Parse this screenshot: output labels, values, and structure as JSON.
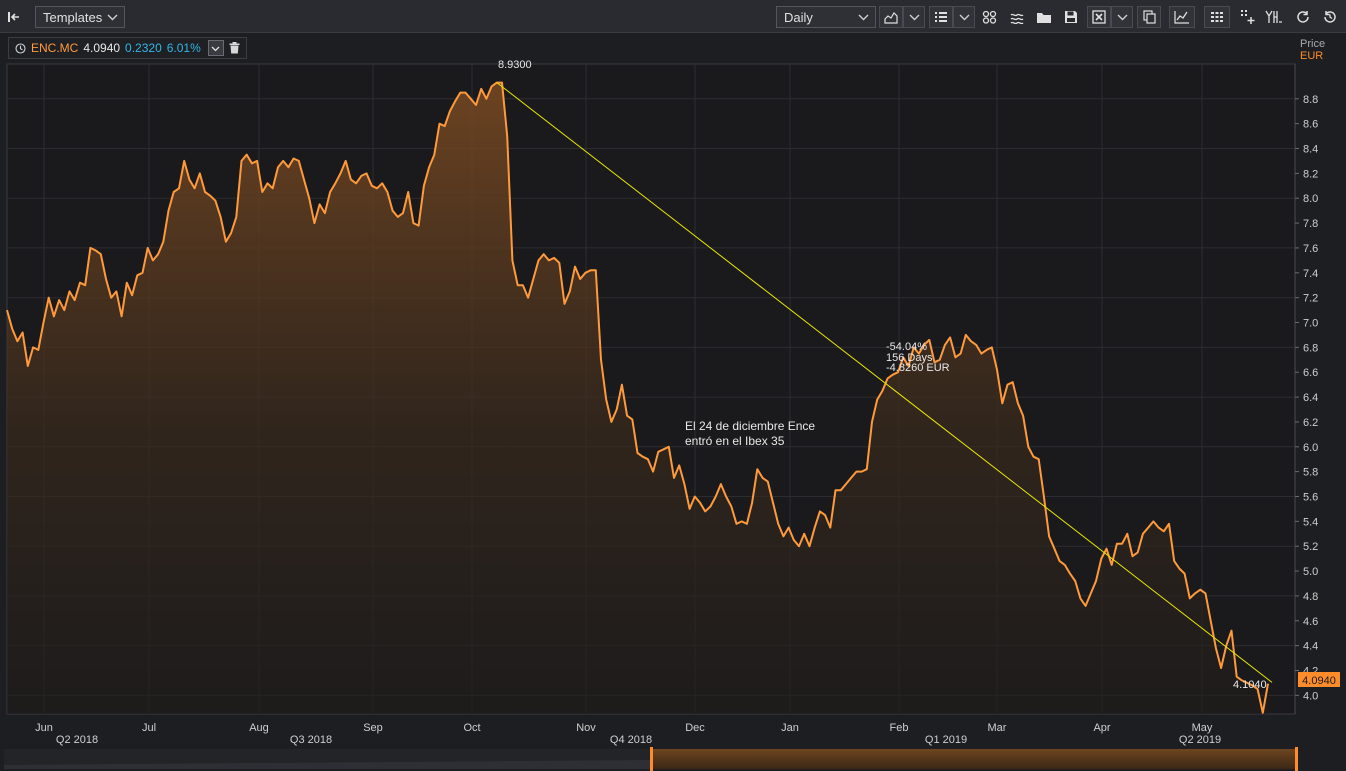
{
  "toolbar": {
    "templates_label": "Templates",
    "interval_label": "Daily"
  },
  "legend": {
    "symbol": "ENC.MC",
    "last": "4.0940",
    "change": "0.2320",
    "change_pct": "6.01%"
  },
  "axis": {
    "price_label": "Price",
    "currency_label": "EUR"
  },
  "colors": {
    "series": "#ff9a3c",
    "trendline": "#e6e600",
    "change": "#33b5e5",
    "last_price_tag": "#ff8c2a"
  },
  "chart_data": {
    "type": "area",
    "ylim": [
      3.85,
      9.08
    ],
    "y_ticks": [
      "4.0",
      "4.2",
      "4.4",
      "4.6",
      "4.8",
      "5.0",
      "5.2",
      "5.4",
      "5.6",
      "5.8",
      "6.0",
      "6.2",
      "6.4",
      "6.6",
      "6.8",
      "7.0",
      "7.2",
      "7.4",
      "7.6",
      "7.8",
      "8.0",
      "8.2",
      "8.4",
      "8.6",
      "8.8"
    ],
    "x_month_labels": [
      "Jun",
      "Jul",
      "Aug",
      "Sep",
      "Oct",
      "Nov",
      "Dec",
      "Jan",
      "Feb",
      "Mar",
      "Apr",
      "May"
    ],
    "x_quarter_labels": [
      "Q2 2018",
      "Q3 2018",
      "Q4 2018",
      "Q1 2019",
      "Q2 2019"
    ],
    "series": [
      {
        "values": [
          7.1,
          6.95,
          6.85,
          6.92,
          6.65,
          6.8,
          6.78,
          7.0,
          7.2,
          7.05,
          7.18,
          7.1,
          7.25,
          7.18,
          7.32,
          7.3,
          7.6,
          7.58,
          7.55,
          7.35,
          7.2,
          7.25,
          7.05,
          7.32,
          7.22,
          7.38,
          7.4,
          7.6,
          7.5,
          7.55,
          7.65,
          7.9,
          8.05,
          8.08,
          8.3,
          8.15,
          8.08,
          8.2,
          8.05,
          8.02,
          7.98,
          7.85,
          7.65,
          7.72,
          7.85,
          8.3,
          8.35,
          8.28,
          8.3,
          8.05,
          8.12,
          8.08,
          8.25,
          8.3,
          8.25,
          8.32,
          8.3,
          8.15,
          8.0,
          7.8,
          7.95,
          7.88,
          8.05,
          8.12,
          8.2,
          8.3,
          8.15,
          8.12,
          8.18,
          8.2,
          8.1,
          8.08,
          8.12,
          8.05,
          7.9,
          7.85,
          7.88,
          8.05,
          7.8,
          7.78,
          8.1,
          8.25,
          8.35,
          8.6,
          8.58,
          8.7,
          8.78,
          8.85,
          8.85,
          8.8,
          8.75,
          8.88,
          8.8,
          8.9,
          8.93,
          8.93,
          8.5,
          7.5,
          7.3,
          7.3,
          7.2,
          7.35,
          7.5,
          7.55,
          7.5,
          7.52,
          7.48,
          7.15,
          7.25,
          7.45,
          7.35,
          7.4,
          7.42,
          7.42,
          6.7,
          6.38,
          6.2,
          6.3,
          6.5,
          6.25,
          6.22,
          5.95,
          5.92,
          5.9,
          5.8,
          5.96,
          5.98,
          6.0,
          5.75,
          5.85,
          5.7,
          5.5,
          5.6,
          5.55,
          5.48,
          5.52,
          5.6,
          5.7,
          5.6,
          5.52,
          5.38,
          5.4,
          5.38,
          5.55,
          5.82,
          5.75,
          5.72,
          5.55,
          5.38,
          5.28,
          5.35,
          5.25,
          5.2,
          5.3,
          5.2,
          5.35,
          5.48,
          5.45,
          5.35,
          5.65,
          5.65,
          5.7,
          5.75,
          5.8,
          5.8,
          5.82,
          6.2,
          6.38,
          6.45,
          6.55,
          6.58,
          6.6,
          6.72,
          6.65,
          6.8,
          6.75,
          6.82,
          6.86,
          6.68,
          6.7,
          6.82,
          6.88,
          6.72,
          6.75,
          6.9,
          6.85,
          6.82,
          6.75,
          6.78,
          6.8,
          6.62,
          6.35,
          6.5,
          6.52,
          6.35,
          6.25,
          6.0,
          5.92,
          5.9,
          5.6,
          5.28,
          5.18,
          5.08,
          5.05,
          4.98,
          4.92,
          4.78,
          4.72,
          4.82,
          4.92,
          5.1,
          5.18,
          5.05,
          5.22,
          5.22,
          5.3,
          5.12,
          5.15,
          5.3,
          5.35,
          5.4,
          5.35,
          5.32,
          5.38,
          5.08,
          5.02,
          4.98,
          4.78,
          4.82,
          4.85,
          4.82,
          4.6,
          4.38,
          4.22,
          4.4,
          4.52,
          4.15,
          4.12,
          4.1,
          4.08,
          4.05,
          3.86,
          4.094
        ]
      }
    ],
    "trendline": {
      "start_value": 8.93,
      "end_value": 4.104,
      "start_label": "8.9300",
      "end_label": "4.1040",
      "stats": [
        "-54.04%",
        "156 Days",
        "-4.8260 EUR"
      ]
    },
    "annotation": [
      "El 24 de diciembre Ence",
      "entró en el Ibex 35"
    ],
    "last_price_tag": "4.0940",
    "grid": true
  }
}
